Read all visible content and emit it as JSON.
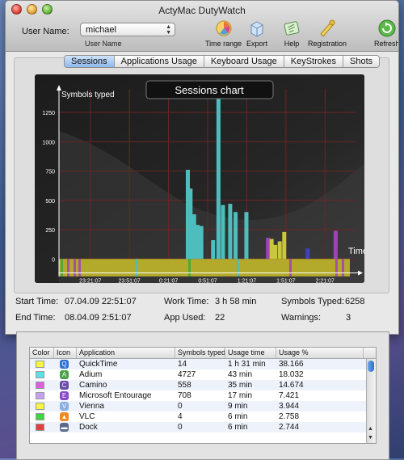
{
  "window": {
    "title": "ActyMac DutyWatch"
  },
  "user": {
    "label": "User Name:",
    "selected": "michael",
    "sublabel": "User Name"
  },
  "toolbar": [
    {
      "label": "Time range",
      "icon": "time-range-icon"
    },
    {
      "label": "Export",
      "icon": "export-icon"
    },
    {
      "label": "Help",
      "icon": "help-icon"
    },
    {
      "label": "Registration",
      "icon": "registration-icon"
    },
    {
      "label": "Refresh",
      "icon": "refresh-icon"
    }
  ],
  "tabs": [
    "Sessions",
    "Applications Usage",
    "Keyboard Usage",
    "KeyStrokes",
    "Shots"
  ],
  "active_tab": "Sessions",
  "chart_data": {
    "type": "bar",
    "title": "Sessions chart",
    "ylabel": "Symbols typed",
    "xlabel": "Time",
    "yticks": [
      0,
      250,
      500,
      750,
      1000,
      1250
    ],
    "xticks": [
      "23:21:07",
      "23:51:07",
      "0:21:07",
      "0:51:07",
      "1:21:07",
      "1:51:07",
      "2:21:07"
    ],
    "ylim": [
      -150,
      1450
    ],
    "xlim": [
      0,
      330
    ],
    "background_color": "#b3a92a",
    "colors": {
      "cyan": "#4fbdbd",
      "purple": "#a043b8",
      "green": "#3ea83e",
      "yellow": "#c8c83a",
      "blue": "#4040c0"
    },
    "series": [
      {
        "color": "cyan",
        "x": 143,
        "value": 760
      },
      {
        "color": "cyan",
        "x": 146,
        "value": 600
      },
      {
        "color": "cyan",
        "x": 150,
        "value": 380
      },
      {
        "color": "cyan",
        "x": 154,
        "value": 290
      },
      {
        "color": "cyan",
        "x": 158,
        "value": 280
      },
      {
        "color": "cyan",
        "x": 171,
        "value": 160
      },
      {
        "color": "cyan",
        "x": 177,
        "value": 1420
      },
      {
        "color": "cyan",
        "x": 182,
        "value": 460
      },
      {
        "color": "cyan",
        "x": 190,
        "value": 470
      },
      {
        "color": "cyan",
        "x": 196,
        "value": 400
      },
      {
        "color": "cyan",
        "x": 208,
        "value": 400
      },
      {
        "color": "purple",
        "x": 232,
        "value": 180
      },
      {
        "color": "yellow",
        "x": 236,
        "value": 170
      },
      {
        "color": "yellow",
        "x": 240,
        "value": 120
      },
      {
        "color": "yellow",
        "x": 245,
        "value": 150
      },
      {
        "color": "yellow",
        "x": 250,
        "value": 230
      },
      {
        "color": "blue",
        "x": 276,
        "value": 90
      },
      {
        "color": "purple",
        "x": 307,
        "value": 240
      }
    ]
  },
  "stats": {
    "start_label": "Start Time:",
    "start_value": "07.04.09 22:51:07",
    "end_label": "End Time:",
    "end_value": "08.04.09 2:51:07",
    "work_label": "Work Time:",
    "work_value": "3 h 58 min",
    "app_label": "App Used:",
    "app_value": "22",
    "symbols_label": "Symbols Typed:",
    "symbols_value": "6258",
    "warnings_label": "Warnings:",
    "warnings_value": "3"
  },
  "table": {
    "headers": [
      "Color",
      "Icon",
      "Application",
      "Symbols typed",
      "Usage time",
      "Usage %"
    ],
    "rows": [
      {
        "color": "#f5f542",
        "icon": "quicktime-icon",
        "icon_color": "#2a6fd6",
        "icon_glyph": "Q",
        "app": "QuickTime",
        "symbols": "14",
        "time": "1 h 31 min",
        "pct": "38.166"
      },
      {
        "color": "#5de0e6",
        "icon": "adium-icon",
        "icon_color": "#4aa24a",
        "icon_glyph": "A",
        "app": "Adium",
        "symbols": "4727",
        "time": "43 min",
        "pct": "18.032"
      },
      {
        "color": "#e05ce0",
        "icon": "camino-icon",
        "icon_color": "#6b4aa8",
        "icon_glyph": "C",
        "app": "Camino",
        "symbols": "558",
        "time": "35 min",
        "pct": "14.674"
      },
      {
        "color": "#c8a0f0",
        "icon": "entourage-icon",
        "icon_color": "#8a4ac8",
        "icon_glyph": "E",
        "app": "Microsoft Entourage",
        "symbols": "708",
        "time": "17 min",
        "pct": "7.421"
      },
      {
        "color": "#f5f542",
        "icon": "vienna-icon",
        "icon_color": "#8ab0e0",
        "icon_glyph": "V",
        "app": "Vienna",
        "symbols": "0",
        "time": "9 min",
        "pct": "3.944"
      },
      {
        "color": "#3ed63e",
        "icon": "vlc-icon",
        "icon_color": "#f08a1e",
        "icon_glyph": "▲",
        "app": "VLC",
        "symbols": "4",
        "time": "6 min",
        "pct": "2.758"
      },
      {
        "color": "#e04040",
        "icon": "dock-icon",
        "icon_color": "#5a6a8a",
        "icon_glyph": "▬",
        "app": "Dock",
        "symbols": "0",
        "time": "6 min",
        "pct": "2.744"
      }
    ]
  }
}
